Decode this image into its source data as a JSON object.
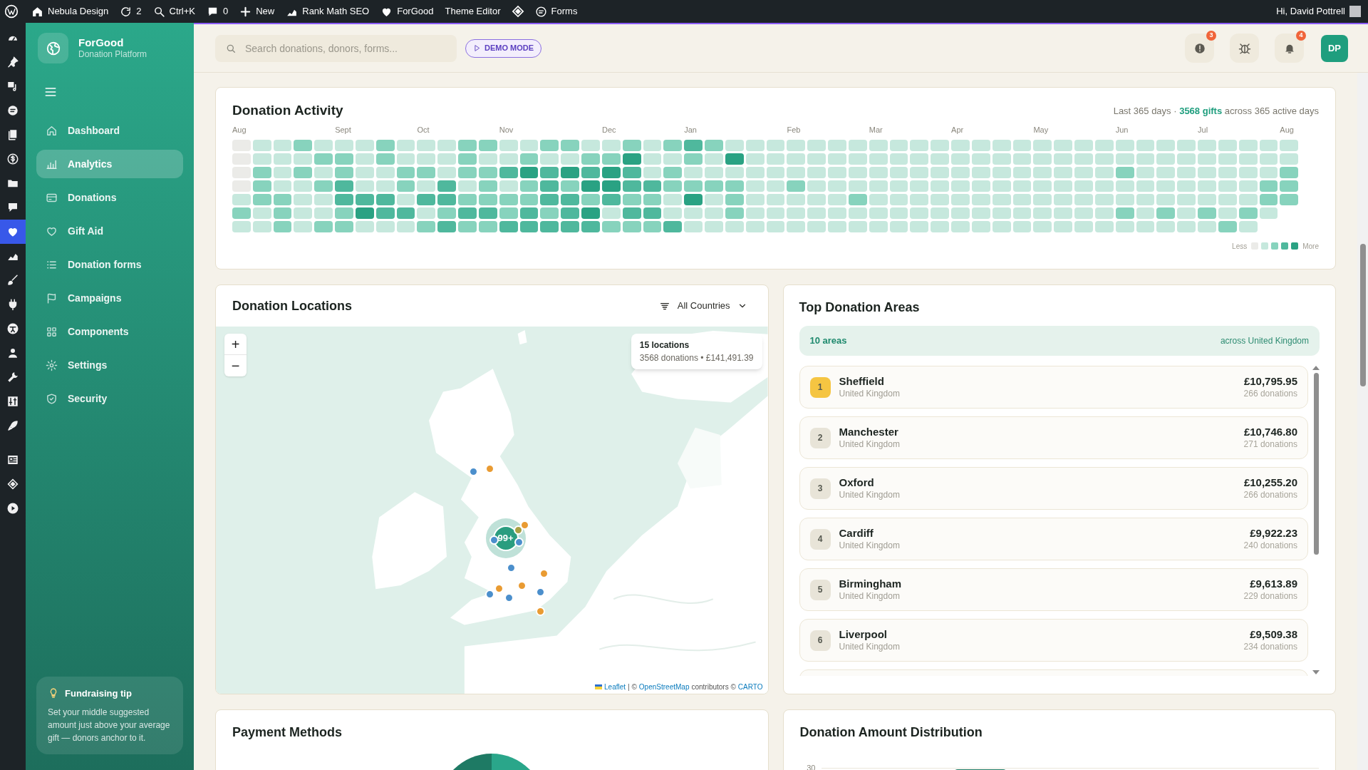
{
  "admin_bar": {
    "items": [
      {
        "label": "Nebula Design"
      },
      {
        "label": "2"
      },
      {
        "label": "Ctrl+K"
      },
      {
        "label": "0"
      },
      {
        "label": "New"
      },
      {
        "label": "Rank Math SEO"
      },
      {
        "label": "ForGood"
      },
      {
        "label": "Theme Editor"
      },
      {
        "label": "Forms"
      }
    ],
    "greeting": "Hi, David Pottrell"
  },
  "admin_menu": [
    {
      "selected": false
    },
    {
      "selected": false
    },
    {
      "selected": false
    },
    {
      "selected": false
    },
    {
      "selected": false
    },
    {
      "selected": false
    },
    {
      "selected": false
    },
    {
      "selected": false
    },
    {
      "selected": true
    },
    {
      "selected": false
    },
    {
      "selected": false
    },
    {
      "selected": false
    },
    {
      "selected": false
    },
    {
      "selected": false
    },
    {
      "selected": false
    },
    {
      "selected": false
    },
    {
      "selected": false
    },
    {
      "selected": false
    },
    {
      "selected": false
    },
    {
      "selected": false
    }
  ],
  "sidebar": {
    "brand": {
      "name": "ForGood",
      "subtitle": "Donation Platform"
    },
    "nav": [
      {
        "label": "Dashboard",
        "selected": false
      },
      {
        "label": "Analytics",
        "selected": true
      },
      {
        "label": "Donations",
        "selected": false
      },
      {
        "label": "Gift Aid",
        "selected": false
      },
      {
        "label": "Donation forms",
        "selected": false
      },
      {
        "label": "Campaigns",
        "selected": false
      },
      {
        "label": "Components",
        "selected": false
      },
      {
        "label": "Settings",
        "selected": false
      },
      {
        "label": "Security",
        "selected": false
      }
    ],
    "tip": {
      "title": "Fundraising tip",
      "text": "Set your middle suggested amount just above your average gift — donors anchor to it."
    }
  },
  "header": {
    "search": {
      "placeholder": "Search donations, donors, forms..."
    },
    "demo_badge": "DEMO MODE",
    "alerts_badge": "3",
    "notifications_badge": "4",
    "avatar": "DP"
  },
  "activity": {
    "title": "Donation Activity",
    "summary": "Last 365 days · **3568 gifts** across 365 active days",
    "weeks": [
      {
        "month": "Aug",
        "days": [
          {
            "color": "#ebebe8"
          },
          {
            "color": "#ebebe8"
          },
          {
            "color": "#ebebe8"
          },
          {
            "color": "#ebebe8"
          },
          {
            "color": "#c6e8dd"
          },
          {
            "color": "#87d3bd"
          },
          {
            "color": "#c6e8dd"
          }
        ]
      },
      {
        "days": [
          {
            "color": "#c6e8dd"
          },
          {
            "color": "#c6e8dd"
          },
          {
            "color": "#87d3bd"
          },
          {
            "color": "#87d3bd"
          },
          {
            "color": "#87d3bd"
          },
          {
            "color": "#c6e8dd"
          },
          {
            "color": "#c6e8dd"
          }
        ]
      },
      {
        "days": [
          {
            "color": "#c6e8dd"
          },
          {
            "color": "#c6e8dd"
          },
          {
            "color": "#c6e8dd"
          },
          {
            "color": "#c6e8dd"
          },
          {
            "color": "#87d3bd"
          },
          {
            "color": "#87d3bd"
          },
          {
            "color": "#87d3bd"
          }
        ]
      },
      {
        "days": [
          {
            "color": "#87d3bd"
          },
          {
            "color": "#c6e8dd"
          },
          {
            "color": "#87d3bd"
          },
          {
            "color": "#c6e8dd"
          },
          {
            "color": "#c6e8dd"
          },
          {
            "color": "#c6e8dd"
          },
          {
            "color": "#c6e8dd"
          }
        ]
      },
      {
        "days": [
          {
            "color": "#c6e8dd"
          },
          {
            "color": "#87d3bd"
          },
          {
            "color": "#c6e8dd"
          },
          {
            "color": "#87d3bd"
          },
          {
            "color": "#c6e8dd"
          },
          {
            "color": "#c6e8dd"
          },
          {
            "color": "#87d3bd"
          }
        ]
      },
      {
        "month": "Sept",
        "days": [
          {
            "color": "#c6e8dd"
          },
          {
            "color": "#87d3bd"
          },
          {
            "color": "#87d3bd"
          },
          {
            "color": "#4fb89d"
          },
          {
            "color": "#4fb89d"
          },
          {
            "color": "#87d3bd"
          },
          {
            "color": "#87d3bd"
          }
        ]
      },
      {
        "days": [
          {
            "color": "#c6e8dd"
          },
          {
            "color": "#c6e8dd"
          },
          {
            "color": "#c6e8dd"
          },
          {
            "color": "#c6e8dd"
          },
          {
            "color": "#4fb89d"
          },
          {
            "color": "#2aa283"
          },
          {
            "color": "#c6e8dd"
          }
        ]
      },
      {
        "days": [
          {
            "color": "#87d3bd"
          },
          {
            "color": "#87d3bd"
          },
          {
            "color": "#c6e8dd"
          },
          {
            "color": "#c6e8dd"
          },
          {
            "color": "#4fb89d"
          },
          {
            "color": "#4fb89d"
          },
          {
            "color": "#c6e8dd"
          }
        ]
      },
      {
        "days": [
          {
            "color": "#c6e8dd"
          },
          {
            "color": "#c6e8dd"
          },
          {
            "color": "#87d3bd"
          },
          {
            "color": "#87d3bd"
          },
          {
            "color": "#c6e8dd"
          },
          {
            "color": "#4fb89d"
          },
          {
            "color": "#c6e8dd"
          }
        ]
      },
      {
        "month": "Oct",
        "days": [
          {
            "color": "#c6e8dd"
          },
          {
            "color": "#c6e8dd"
          },
          {
            "color": "#87d3bd"
          },
          {
            "color": "#c6e8dd"
          },
          {
            "color": "#4fb89d"
          },
          {
            "color": "#c6e8dd"
          },
          {
            "color": "#87d3bd"
          }
        ]
      },
      {
        "days": [
          {
            "color": "#c6e8dd"
          },
          {
            "color": "#c6e8dd"
          },
          {
            "color": "#c6e8dd"
          },
          {
            "color": "#4fb89d"
          },
          {
            "color": "#4fb89d"
          },
          {
            "color": "#87d3bd"
          },
          {
            "color": "#4fb89d"
          }
        ]
      },
      {
        "days": [
          {
            "color": "#87d3bd"
          },
          {
            "color": "#87d3bd"
          },
          {
            "color": "#87d3bd"
          },
          {
            "color": "#c6e8dd"
          },
          {
            "color": "#87d3bd"
          },
          {
            "color": "#4fb89d"
          },
          {
            "color": "#87d3bd"
          }
        ]
      },
      {
        "days": [
          {
            "color": "#87d3bd"
          },
          {
            "color": "#c6e8dd"
          },
          {
            "color": "#87d3bd"
          },
          {
            "color": "#87d3bd"
          },
          {
            "color": "#87d3bd"
          },
          {
            "color": "#4fb89d"
          },
          {
            "color": "#87d3bd"
          }
        ]
      },
      {
        "month": "Nov",
        "days": [
          {
            "color": "#c6e8dd"
          },
          {
            "color": "#c6e8dd"
          },
          {
            "color": "#4fb89d"
          },
          {
            "color": "#c6e8dd"
          },
          {
            "color": "#87d3bd"
          },
          {
            "color": "#87d3bd"
          },
          {
            "color": "#4fb89d"
          }
        ]
      },
      {
        "days": [
          {
            "color": "#c6e8dd"
          },
          {
            "color": "#87d3bd"
          },
          {
            "color": "#2aa283"
          },
          {
            "color": "#87d3bd"
          },
          {
            "color": "#87d3bd"
          },
          {
            "color": "#4fb89d"
          },
          {
            "color": "#4fb89d"
          }
        ]
      },
      {
        "days": [
          {
            "color": "#87d3bd"
          },
          {
            "color": "#c6e8dd"
          },
          {
            "color": "#4fb89d"
          },
          {
            "color": "#4fb89d"
          },
          {
            "color": "#4fb89d"
          },
          {
            "color": "#87d3bd"
          },
          {
            "color": "#4fb89d"
          }
        ]
      },
      {
        "days": [
          {
            "color": "#87d3bd"
          },
          {
            "color": "#c6e8dd"
          },
          {
            "color": "#2aa283"
          },
          {
            "color": "#87d3bd"
          },
          {
            "color": "#4fb89d"
          },
          {
            "color": "#4fb89d"
          },
          {
            "color": "#4fb89d"
          }
        ]
      },
      {
        "days": [
          {
            "color": "#c6e8dd"
          },
          {
            "color": "#87d3bd"
          },
          {
            "color": "#4fb89d"
          },
          {
            "color": "#2aa283"
          },
          {
            "color": "#87d3bd"
          },
          {
            "color": "#2aa283"
          },
          {
            "color": "#4fb89d"
          }
        ]
      },
      {
        "month": "Dec",
        "days": [
          {
            "color": "#c6e8dd"
          },
          {
            "color": "#87d3bd"
          },
          {
            "color": "#2aa283"
          },
          {
            "color": "#2aa283"
          },
          {
            "color": "#4fb89d"
          },
          {
            "color": "#c6e8dd"
          },
          {
            "color": "#87d3bd"
          }
        ]
      },
      {
        "days": [
          {
            "color": "#87d3bd"
          },
          {
            "color": "#2aa283"
          },
          {
            "color": "#4fb89d"
          },
          {
            "color": "#4fb89d"
          },
          {
            "color": "#87d3bd"
          },
          {
            "color": "#4fb89d"
          },
          {
            "color": "#87d3bd"
          }
        ]
      },
      {
        "days": [
          {
            "color": "#c6e8dd"
          },
          {
            "color": "#c6e8dd"
          },
          {
            "color": "#c6e8dd"
          },
          {
            "color": "#4fb89d"
          },
          {
            "color": "#87d3bd"
          },
          {
            "color": "#4fb89d"
          },
          {
            "color": "#87d3bd"
          }
        ]
      },
      {
        "days": [
          {
            "color": "#87d3bd"
          },
          {
            "color": "#c6e8dd"
          },
          {
            "color": "#87d3bd"
          },
          {
            "color": "#87d3bd"
          },
          {
            "color": "#c6e8dd"
          },
          {
            "color": "#c6e8dd"
          },
          {
            "color": "#4fb89d"
          }
        ]
      },
      {
        "month": "Jan",
        "days": [
          {
            "color": "#4fb89d"
          },
          {
            "color": "#87d3bd"
          },
          {
            "color": "#c6e8dd"
          },
          {
            "color": "#87d3bd"
          },
          {
            "color": "#2aa283"
          },
          {
            "color": "#c6e8dd"
          },
          {
            "color": "#c6e8dd"
          }
        ]
      },
      {
        "days": [
          {
            "color": "#87d3bd"
          },
          {
            "color": "#c6e8dd"
          },
          {
            "color": "#c6e8dd"
          },
          {
            "color": "#87d3bd"
          },
          {
            "color": "#c6e8dd"
          },
          {
            "color": "#c6e8dd"
          },
          {
            "color": "#c6e8dd"
          }
        ]
      },
      {
        "days": [
          {
            "color": "#c6e8dd"
          },
          {
            "color": "#2aa283"
          },
          {
            "color": "#c6e8dd"
          },
          {
            "color": "#87d3bd"
          },
          {
            "color": "#87d3bd"
          },
          {
            "color": "#87d3bd"
          },
          {
            "color": "#c6e8dd"
          }
        ]
      },
      {
        "days": [
          {
            "color": "#c6e8dd"
          },
          {
            "color": "#c6e8dd"
          },
          {
            "color": "#c6e8dd"
          },
          {
            "color": "#c6e8dd"
          },
          {
            "color": "#c6e8dd"
          },
          {
            "color": "#c6e8dd"
          },
          {
            "color": "#c6e8dd"
          }
        ]
      },
      {
        "days": [
          {
            "color": "#c6e8dd"
          },
          {
            "color": "#c6e8dd"
          },
          {
            "color": "#c6e8dd"
          },
          {
            "color": "#c6e8dd"
          },
          {
            "color": "#c6e8dd"
          },
          {
            "color": "#c6e8dd"
          },
          {
            "color": "#c6e8dd"
          }
        ]
      },
      {
        "month": "Feb",
        "days": [
          {
            "color": "#c6e8dd"
          },
          {
            "color": "#c6e8dd"
          },
          {
            "color": "#c6e8dd"
          },
          {
            "color": "#87d3bd"
          },
          {
            "color": "#c6e8dd"
          },
          {
            "color": "#c6e8dd"
          },
          {
            "color": "#c6e8dd"
          }
        ]
      },
      {
        "days": [
          {
            "color": "#c6e8dd"
          },
          {
            "color": "#c6e8dd"
          },
          {
            "color": "#c6e8dd"
          },
          {
            "color": "#c6e8dd"
          },
          {
            "color": "#c6e8dd"
          },
          {
            "color": "#c6e8dd"
          },
          {
            "color": "#c6e8dd"
          }
        ]
      },
      {
        "days": [
          {
            "color": "#c6e8dd"
          },
          {
            "color": "#c6e8dd"
          },
          {
            "color": "#c6e8dd"
          },
          {
            "color": "#c6e8dd"
          },
          {
            "color": "#c6e8dd"
          },
          {
            "color": "#c6e8dd"
          },
          {
            "color": "#c6e8dd"
          }
        ]
      },
      {
        "days": [
          {
            "color": "#c6e8dd"
          },
          {
            "color": "#c6e8dd"
          },
          {
            "color": "#c6e8dd"
          },
          {
            "color": "#c6e8dd"
          },
          {
            "color": "#87d3bd"
          },
          {
            "color": "#c6e8dd"
          },
          {
            "color": "#c6e8dd"
          }
        ]
      },
      {
        "month": "Mar",
        "days": [
          {
            "color": "#c6e8dd"
          },
          {
            "color": "#c6e8dd"
          },
          {
            "color": "#c6e8dd"
          },
          {
            "color": "#c6e8dd"
          },
          {
            "color": "#c6e8dd"
          },
          {
            "color": "#c6e8dd"
          },
          {
            "color": "#c6e8dd"
          }
        ]
      },
      {
        "days": [
          {
            "color": "#c6e8dd"
          },
          {
            "color": "#c6e8dd"
          },
          {
            "color": "#c6e8dd"
          },
          {
            "color": "#c6e8dd"
          },
          {
            "color": "#c6e8dd"
          },
          {
            "color": "#c6e8dd"
          },
          {
            "color": "#c6e8dd"
          }
        ]
      },
      {
        "days": [
          {
            "color": "#c6e8dd"
          },
          {
            "color": "#c6e8dd"
          },
          {
            "color": "#c6e8dd"
          },
          {
            "color": "#c6e8dd"
          },
          {
            "color": "#c6e8dd"
          },
          {
            "color": "#c6e8dd"
          },
          {
            "color": "#c6e8dd"
          }
        ]
      },
      {
        "days": [
          {
            "color": "#c6e8dd"
          },
          {
            "color": "#c6e8dd"
          },
          {
            "color": "#c6e8dd"
          },
          {
            "color": "#c6e8dd"
          },
          {
            "color": "#c6e8dd"
          },
          {
            "color": "#c6e8dd"
          },
          {
            "color": "#c6e8dd"
          }
        ]
      },
      {
        "month": "Apr",
        "days": [
          {
            "color": "#c6e8dd"
          },
          {
            "color": "#c6e8dd"
          },
          {
            "color": "#c6e8dd"
          },
          {
            "color": "#c6e8dd"
          },
          {
            "color": "#c6e8dd"
          },
          {
            "color": "#c6e8dd"
          },
          {
            "color": "#c6e8dd"
          }
        ]
      },
      {
        "days": [
          {
            "color": "#c6e8dd"
          },
          {
            "color": "#c6e8dd"
          },
          {
            "color": "#c6e8dd"
          },
          {
            "color": "#c6e8dd"
          },
          {
            "color": "#c6e8dd"
          },
          {
            "color": "#c6e8dd"
          },
          {
            "color": "#c6e8dd"
          }
        ]
      },
      {
        "days": [
          {
            "color": "#c6e8dd"
          },
          {
            "color": "#c6e8dd"
          },
          {
            "color": "#c6e8dd"
          },
          {
            "color": "#c6e8dd"
          },
          {
            "color": "#c6e8dd"
          },
          {
            "color": "#c6e8dd"
          },
          {
            "color": "#c6e8dd"
          }
        ]
      },
      {
        "days": [
          {
            "color": "#c6e8dd"
          },
          {
            "color": "#c6e8dd"
          },
          {
            "color": "#c6e8dd"
          },
          {
            "color": "#c6e8dd"
          },
          {
            "color": "#c6e8dd"
          },
          {
            "color": "#c6e8dd"
          },
          {
            "color": "#c6e8dd"
          }
        ]
      },
      {
        "month": "May",
        "days": [
          {
            "color": "#c6e8dd"
          },
          {
            "color": "#c6e8dd"
          },
          {
            "color": "#c6e8dd"
          },
          {
            "color": "#c6e8dd"
          },
          {
            "color": "#c6e8dd"
          },
          {
            "color": "#c6e8dd"
          },
          {
            "color": "#c6e8dd"
          }
        ]
      },
      {
        "days": [
          {
            "color": "#c6e8dd"
          },
          {
            "color": "#c6e8dd"
          },
          {
            "color": "#c6e8dd"
          },
          {
            "color": "#c6e8dd"
          },
          {
            "color": "#c6e8dd"
          },
          {
            "color": "#c6e8dd"
          },
          {
            "color": "#c6e8dd"
          }
        ]
      },
      {
        "days": [
          {
            "color": "#c6e8dd"
          },
          {
            "color": "#c6e8dd"
          },
          {
            "color": "#c6e8dd"
          },
          {
            "color": "#c6e8dd"
          },
          {
            "color": "#c6e8dd"
          },
          {
            "color": "#c6e8dd"
          },
          {
            "color": "#c6e8dd"
          }
        ]
      },
      {
        "days": [
          {
            "color": "#c6e8dd"
          },
          {
            "color": "#c6e8dd"
          },
          {
            "color": "#c6e8dd"
          },
          {
            "color": "#c6e8dd"
          },
          {
            "color": "#c6e8dd"
          },
          {
            "color": "#c6e8dd"
          },
          {
            "color": "#c6e8dd"
          }
        ]
      },
      {
        "month": "Jun",
        "days": [
          {
            "color": "#c6e8dd"
          },
          {
            "color": "#c6e8dd"
          },
          {
            "color": "#87d3bd"
          },
          {
            "color": "#c6e8dd"
          },
          {
            "color": "#c6e8dd"
          },
          {
            "color": "#87d3bd"
          },
          {
            "color": "#c6e8dd"
          }
        ]
      },
      {
        "days": [
          {
            "color": "#c6e8dd"
          },
          {
            "color": "#c6e8dd"
          },
          {
            "color": "#c6e8dd"
          },
          {
            "color": "#c6e8dd"
          },
          {
            "color": "#c6e8dd"
          },
          {
            "color": "#c6e8dd"
          },
          {
            "color": "#c6e8dd"
          }
        ]
      },
      {
        "days": [
          {
            "color": "#c6e8dd"
          },
          {
            "color": "#c6e8dd"
          },
          {
            "color": "#c6e8dd"
          },
          {
            "color": "#c6e8dd"
          },
          {
            "color": "#c6e8dd"
          },
          {
            "color": "#87d3bd"
          },
          {
            "color": "#c6e8dd"
          }
        ]
      },
      {
        "days": [
          {
            "color": "#c6e8dd"
          },
          {
            "color": "#c6e8dd"
          },
          {
            "color": "#c6e8dd"
          },
          {
            "color": "#c6e8dd"
          },
          {
            "color": "#c6e8dd"
          },
          {
            "color": "#c6e8dd"
          },
          {
            "color": "#c6e8dd"
          }
        ]
      },
      {
        "month": "Jul",
        "days": [
          {
            "color": "#c6e8dd"
          },
          {
            "color": "#c6e8dd"
          },
          {
            "color": "#c6e8dd"
          },
          {
            "color": "#c6e8dd"
          },
          {
            "color": "#c6e8dd"
          },
          {
            "color": "#87d3bd"
          },
          {
            "color": "#c6e8dd"
          }
        ]
      },
      {
        "days": [
          {
            "color": "#c6e8dd"
          },
          {
            "color": "#c6e8dd"
          },
          {
            "color": "#c6e8dd"
          },
          {
            "color": "#c6e8dd"
          },
          {
            "color": "#c6e8dd"
          },
          {
            "color": "#c6e8dd"
          },
          {
            "color": "#87d3bd"
          }
        ]
      },
      {
        "days": [
          {
            "color": "#c6e8dd"
          },
          {
            "color": "#c6e8dd"
          },
          {
            "color": "#c6e8dd"
          },
          {
            "color": "#c6e8dd"
          },
          {
            "color": "#c6e8dd"
          },
          {
            "color": "#87d3bd"
          },
          {
            "color": "#c6e8dd"
          }
        ]
      },
      {
        "days": [
          {
            "color": "#c6e8dd"
          },
          {
            "color": "#c6e8dd"
          },
          {
            "color": "#c6e8dd"
          },
          {
            "color": "#87d3bd"
          },
          {
            "color": "#87d3bd"
          },
          {
            "color": "#c6e8dd"
          }
        ]
      },
      {
        "month": "Aug",
        "days": [
          {
            "color": "#c6e8dd"
          },
          {
            "color": "#c6e8dd"
          },
          {
            "color": "#87d3bd"
          },
          {
            "color": "#87d3bd"
          },
          {
            "color": "#87d3bd"
          }
        ]
      }
    ],
    "legend": {
      "less": "Less",
      "more": "More"
    }
  },
  "locations": {
    "title": "Donation Locations",
    "filter": "All Countries",
    "zoom_in": "+",
    "zoom_out": "−",
    "cluster": "99+",
    "markers": [
      {
        "color": "#4b8fcc"
      },
      {
        "color": "#e99b32"
      },
      {
        "color": "#e99b32"
      },
      {
        "color": "#a8a044"
      },
      {
        "color": "#4b8fcc"
      },
      {
        "color": "#4b8fcc"
      },
      {
        "color": "#4b8fcc"
      },
      {
        "color": "#e99b32"
      },
      {
        "color": "#e99b32"
      },
      {
        "color": "#4b8fcc"
      },
      {
        "color": "#e99b32"
      },
      {
        "color": "#4b8fcc"
      },
      {
        "color": "#4b8fcc"
      },
      {
        "color": "#e99b32"
      }
    ],
    "tooltip": {
      "title": "15 locations",
      "detail": "3568 donations • £141,491.39"
    },
    "attribution": {
      "leaflet": "Leaflet",
      "separator": "| ©",
      "osm": "OpenStreetMap",
      "contributors": "contributors ©",
      "carto": "CARTO"
    }
  },
  "top_areas": {
    "title": "Top Donation Areas",
    "count": "10 areas",
    "scope": "across United Kingdom",
    "areas": [
      {
        "rank": "1",
        "color": "#f5c542",
        "name": "Sheffield",
        "country": "United Kingdom",
        "amount": "£10,795.95",
        "donations": "266 donations"
      },
      {
        "rank": "2",
        "color": "#e8e4d8",
        "name": "Manchester",
        "country": "United Kingdom",
        "amount": "£10,746.80",
        "donations": "271 donations"
      },
      {
        "rank": "3",
        "color": "#e8e4d8",
        "name": "Oxford",
        "country": "United Kingdom",
        "amount": "£10,255.20",
        "donations": "266 donations"
      },
      {
        "rank": "4",
        "color": "#e8e4d8",
        "name": "Cardiff",
        "country": "United Kingdom",
        "amount": "£9,922.23",
        "donations": "240 donations"
      },
      {
        "rank": "5",
        "color": "#e8e4d8",
        "name": "Birmingham",
        "country": "United Kingdom",
        "amount": "£9,613.89",
        "donations": "229 donations"
      },
      {
        "rank": "6",
        "color": "#e8e4d8",
        "name": "Liverpool",
        "country": "United Kingdom",
        "amount": "£9,509.38",
        "donations": "234 donations"
      }
    ]
  },
  "payment_methods": {
    "title": "Payment Methods"
  },
  "distribution": {
    "title": "Donation Amount Distribution",
    "y_tick": "30"
  }
}
